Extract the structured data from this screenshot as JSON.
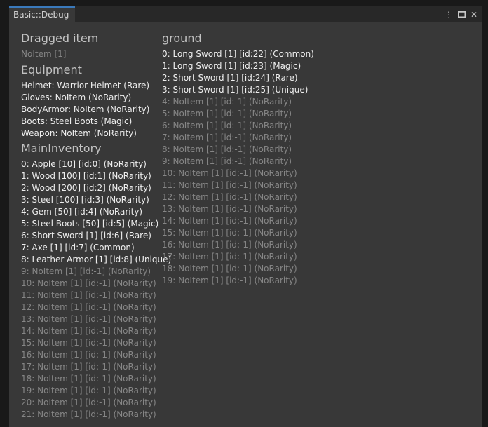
{
  "window": {
    "tab_title": "Basic::Debug",
    "controls": [
      {
        "name": "menu-icon",
        "glyph": "⋮"
      },
      {
        "name": "maximize-icon",
        "glyph": ""
      },
      {
        "name": "close-icon",
        "glyph": "✕"
      }
    ]
  },
  "dragged": {
    "title": "Dragged item",
    "value": "NoItem [1]"
  },
  "equipment": {
    "title": "Equipment",
    "items": [
      "Helmet: Warrior Helmet (Rare)",
      "Gloves: NoItem (NoRarity)",
      "BodyArmor: NoItem (NoRarity)",
      "Boots: Steel Boots (Magic)",
      "Weapon: NoItem (NoRarity)"
    ]
  },
  "main_inventory": {
    "title": "MainInventory",
    "items": [
      {
        "text": "0: Apple [10] [id:0] (NoRarity)",
        "filled": true
      },
      {
        "text": "1: Wood [100] [id:1] (NoRarity)",
        "filled": true
      },
      {
        "text": "2: Wood [200] [id:2] (NoRarity)",
        "filled": true
      },
      {
        "text": "3: Steel [100] [id:3] (NoRarity)",
        "filled": true
      },
      {
        "text": "4: Gem [50] [id:4] (NoRarity)",
        "filled": true
      },
      {
        "text": "5: Steel Boots [50] [id:5] (Magic)",
        "filled": true
      },
      {
        "text": "6: Short Sword [1] [id:6] (Rare)",
        "filled": true
      },
      {
        "text": "7: Axe [1] [id:7] (Common)",
        "filled": true
      },
      {
        "text": "8: Leather Armor [1] [id:8] (Unique)",
        "filled": true
      },
      {
        "text": "9: NoItem [1] [id:-1] (NoRarity)",
        "filled": false
      },
      {
        "text": "10: NoItem [1] [id:-1] (NoRarity)",
        "filled": false
      },
      {
        "text": "11: NoItem [1] [id:-1] (NoRarity)",
        "filled": false
      },
      {
        "text": "12: NoItem [1] [id:-1] (NoRarity)",
        "filled": false
      },
      {
        "text": "13: NoItem [1] [id:-1] (NoRarity)",
        "filled": false
      },
      {
        "text": "14: NoItem [1] [id:-1] (NoRarity)",
        "filled": false
      },
      {
        "text": "15: NoItem [1] [id:-1] (NoRarity)",
        "filled": false
      },
      {
        "text": "16: NoItem [1] [id:-1] (NoRarity)",
        "filled": false
      },
      {
        "text": "17: NoItem [1] [id:-1] (NoRarity)",
        "filled": false
      },
      {
        "text": "18: NoItem [1] [id:-1] (NoRarity)",
        "filled": false
      },
      {
        "text": "19: NoItem [1] [id:-1] (NoRarity)",
        "filled": false
      },
      {
        "text": "20: NoItem [1] [id:-1] (NoRarity)",
        "filled": false
      },
      {
        "text": "21: NoItem [1] [id:-1] (NoRarity)",
        "filled": false
      }
    ]
  },
  "ground": {
    "title": "ground",
    "items": [
      {
        "text": "0: Long Sword [1] [id:22] (Common)",
        "filled": true
      },
      {
        "text": "1: Long Sword [1] [id:23] (Magic)",
        "filled": true
      },
      {
        "text": "2: Short Sword [1] [id:24] (Rare)",
        "filled": true
      },
      {
        "text": "3: Short Sword [1] [id:25] (Unique)",
        "filled": true
      },
      {
        "text": "4: NoItem [1] [id:-1] (NoRarity)",
        "filled": false
      },
      {
        "text": "5: NoItem [1] [id:-1] (NoRarity)",
        "filled": false
      },
      {
        "text": "6: NoItem [1] [id:-1] (NoRarity)",
        "filled": false
      },
      {
        "text": "7: NoItem [1] [id:-1] (NoRarity)",
        "filled": false
      },
      {
        "text": "8: NoItem [1] [id:-1] (NoRarity)",
        "filled": false
      },
      {
        "text": "9: NoItem [1] [id:-1] (NoRarity)",
        "filled": false
      },
      {
        "text": "10: NoItem [1] [id:-1] (NoRarity)",
        "filled": false
      },
      {
        "text": "11: NoItem [1] [id:-1] (NoRarity)",
        "filled": false
      },
      {
        "text": "12: NoItem [1] [id:-1] (NoRarity)",
        "filled": false
      },
      {
        "text": "13: NoItem [1] [id:-1] (NoRarity)",
        "filled": false
      },
      {
        "text": "14: NoItem [1] [id:-1] (NoRarity)",
        "filled": false
      },
      {
        "text": "15: NoItem [1] [id:-1] (NoRarity)",
        "filled": false
      },
      {
        "text": "16: NoItem [1] [id:-1] (NoRarity)",
        "filled": false
      },
      {
        "text": "17: NoItem [1] [id:-1] (NoRarity)",
        "filled": false
      },
      {
        "text": "18: NoItem [1] [id:-1] (NoRarity)",
        "filled": false
      },
      {
        "text": "19: NoItem [1] [id:-1] (NoRarity)",
        "filled": false
      }
    ]
  },
  "colors": {
    "background": "#191919",
    "panel": "#383838",
    "tab_accent": "#3a79bb",
    "filled_text": "#eeeeee",
    "empty_text": "#868686",
    "header_text": "#c2c2c2"
  }
}
